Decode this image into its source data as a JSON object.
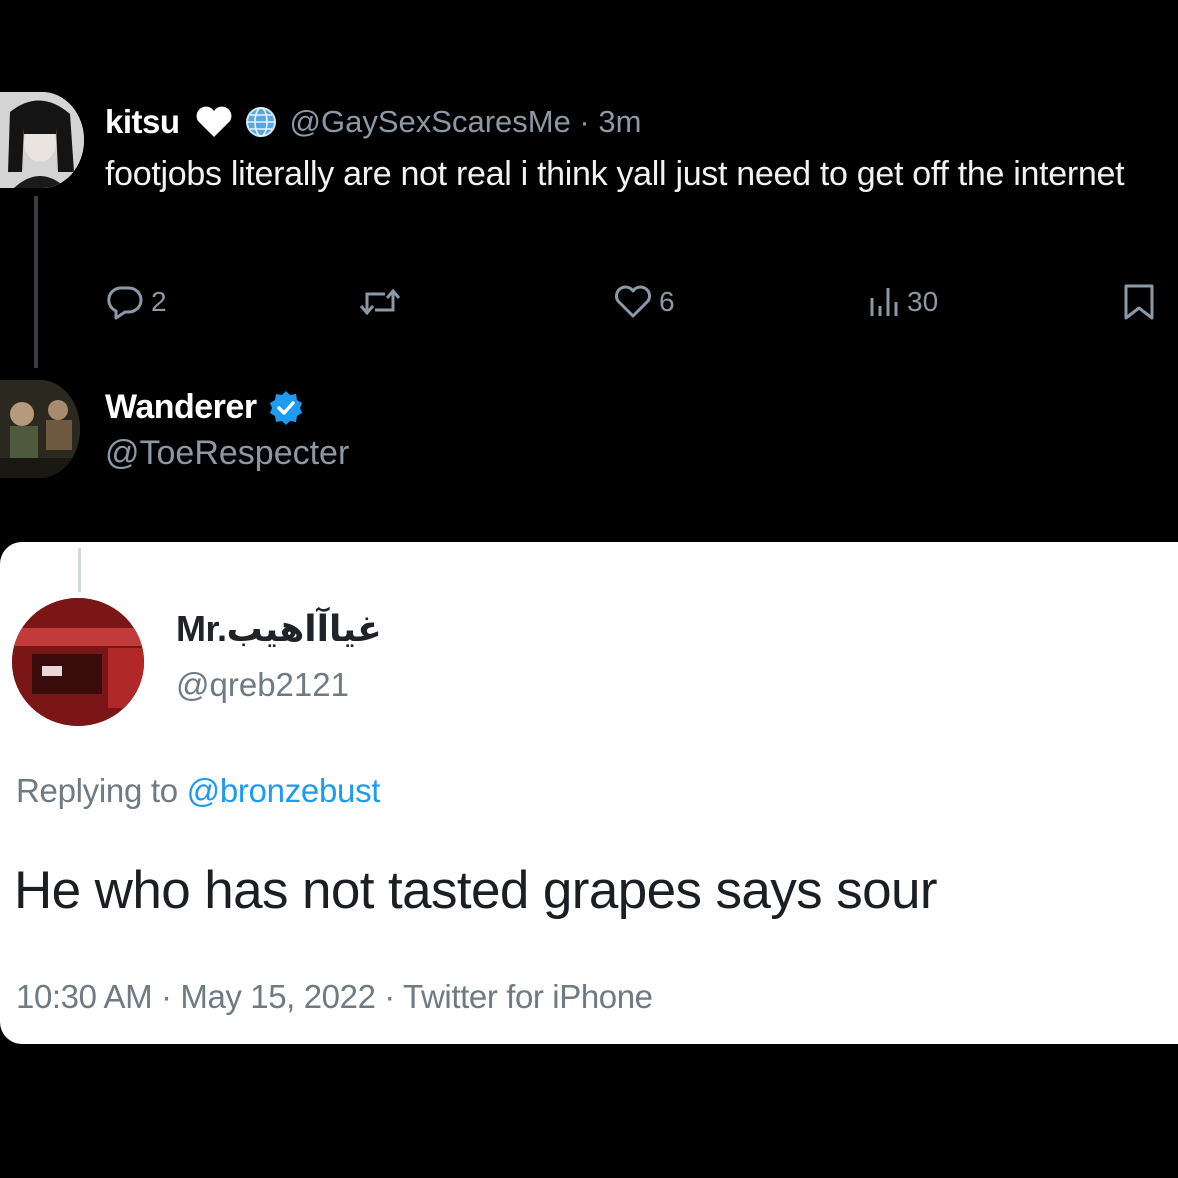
{
  "tweet_main": {
    "display_name": "kitsu",
    "handle_time": "@GaySexScaresMe · 3m",
    "text": "footjobs literally are not real i think yall just need to get off the internet",
    "reply_count": "2",
    "like_count": "6",
    "view_count": "30"
  },
  "reply_tweet": {
    "display_name": "Wanderer",
    "handle": "@ToeRespecter"
  },
  "embedded_tweet": {
    "display_name": "Mr.غياآاهيب",
    "handle": "@qreb2121",
    "replying_prefix": "Replying to ",
    "replying_mention": "@bronzebust",
    "text": "He who has not tasted grapes says sour",
    "meta": "10:30 AM · May 15, 2022 · Twitter for iPhone"
  },
  "colors": {
    "background": "#000000",
    "card_background": "#ffffff",
    "muted_dark": "#8b98a5",
    "muted_light": "#6e7a84",
    "verified": "#1d9bf0",
    "mention": "#1d9bf0"
  },
  "icons": [
    "reply-icon",
    "retweet-icon",
    "like-icon",
    "views-icon",
    "bookmark-icon",
    "verified-badge-icon",
    "heart-emoji-icon",
    "globe-emoji-icon"
  ]
}
